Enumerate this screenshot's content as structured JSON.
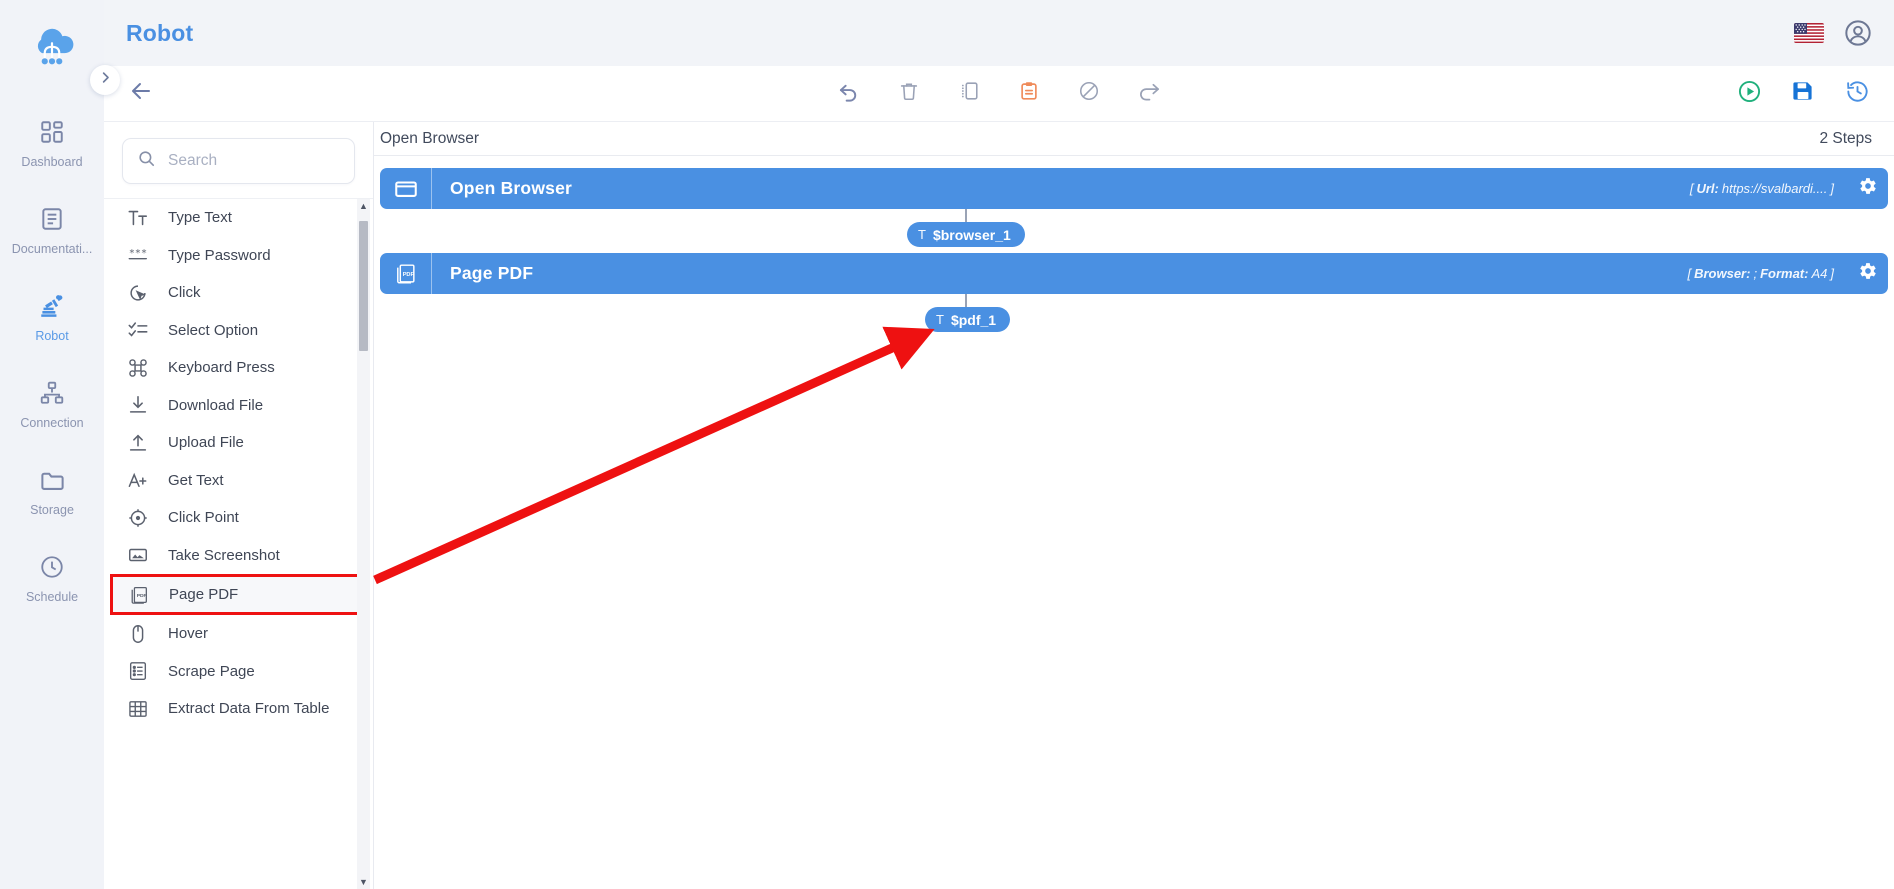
{
  "app": {
    "title": "Robot",
    "flag_icon": "us-flag-icon",
    "user_icon": "user-avatar-icon"
  },
  "sidebar": {
    "logo_icon": "cloud-robot-logo",
    "collapse_icon": "chevron-right-icon",
    "items": [
      {
        "label": "Dashboard",
        "icon": "dashboard-grid-icon",
        "active": false
      },
      {
        "label": "Documentati...",
        "icon": "document-icon",
        "active": false
      },
      {
        "label": "Robot",
        "icon": "robot-arm-icon",
        "active": true
      },
      {
        "label": "Connection",
        "icon": "network-hierarchy-icon",
        "active": false
      },
      {
        "label": "Storage",
        "icon": "folder-icon",
        "active": false
      },
      {
        "label": "Schedule",
        "icon": "clock-icon",
        "active": false
      }
    ]
  },
  "toolbar": {
    "back_icon": "arrow-left-icon",
    "center_buttons": [
      {
        "name": "undo-button",
        "icon": "undo-arrow-icon"
      },
      {
        "name": "delete-button",
        "icon": "trash-icon"
      },
      {
        "name": "copy-button",
        "icon": "copy-icon"
      },
      {
        "name": "paste-button",
        "icon": "clipboard-paste-icon"
      },
      {
        "name": "disable-button",
        "icon": "block-circle-icon"
      },
      {
        "name": "redo-button",
        "icon": "redo-arrow-icon"
      }
    ],
    "right_buttons": [
      {
        "name": "run-button",
        "icon": "play-circle-icon"
      },
      {
        "name": "save-button",
        "icon": "save-disk-icon"
      },
      {
        "name": "history-button",
        "icon": "history-clock-icon"
      }
    ]
  },
  "palette": {
    "search": {
      "placeholder": "Search",
      "value": "",
      "icon": "search-icon"
    },
    "actions": [
      {
        "label": "Type Text",
        "icon": "type-text-icon",
        "highlighted": false
      },
      {
        "label": "Type Password",
        "icon": "password-asterisk-icon",
        "highlighted": false
      },
      {
        "label": "Click",
        "icon": "click-cursor-icon",
        "highlighted": false
      },
      {
        "label": "Select Option",
        "icon": "checklist-icon",
        "highlighted": false
      },
      {
        "label": "Keyboard Press",
        "icon": "command-key-icon",
        "highlighted": false
      },
      {
        "label": "Download File",
        "icon": "download-icon",
        "highlighted": false
      },
      {
        "label": "Upload File",
        "icon": "upload-icon",
        "highlighted": false
      },
      {
        "label": "Get Text",
        "icon": "get-text-a-plus-icon",
        "highlighted": false
      },
      {
        "label": "Click Point",
        "icon": "crosshair-target-icon",
        "highlighted": false
      },
      {
        "label": "Take Screenshot",
        "icon": "screenshot-image-icon",
        "highlighted": false
      },
      {
        "label": "Page PDF",
        "icon": "pdf-pages-icon",
        "highlighted": true
      },
      {
        "label": "Hover",
        "icon": "mouse-icon",
        "highlighted": false
      },
      {
        "label": "Scrape Page",
        "icon": "scrape-list-icon",
        "highlighted": false
      },
      {
        "label": "Extract Data From Table",
        "icon": "table-grid-icon",
        "highlighted": false
      }
    ]
  },
  "canvas": {
    "title": "Open Browser",
    "steps_count": "2 Steps",
    "steps": [
      {
        "title": "Open Browser",
        "icon": "browser-window-icon",
        "params_open": "[",
        "param_key": "Url:",
        "param_value": "https://svalbardi....",
        "params_close": "]",
        "gear_icon": "gear-settings-icon",
        "variable": {
          "prefix": "T",
          "name": "$browser_1"
        }
      },
      {
        "title": "Page PDF",
        "icon": "pdf-pages-icon",
        "params_open": "[",
        "param_key": "Browser:",
        "param_value": ";",
        "param_key2": "Format:",
        "param_value2": "A4",
        "params_close": "]",
        "gear_icon": "gear-settings-icon",
        "variable": {
          "prefix": "T",
          "name": "$pdf_1"
        }
      }
    ]
  },
  "annotation": {
    "arrow_color": "#ee1111",
    "highlight_box_color": "#ee1111"
  },
  "colors": {
    "accent": "#4a90e2",
    "rail_bg": "#f1f3f8",
    "header_bg": "#f2f4f8",
    "run_green": "#22b07d",
    "save_blue": "#1673d6"
  }
}
